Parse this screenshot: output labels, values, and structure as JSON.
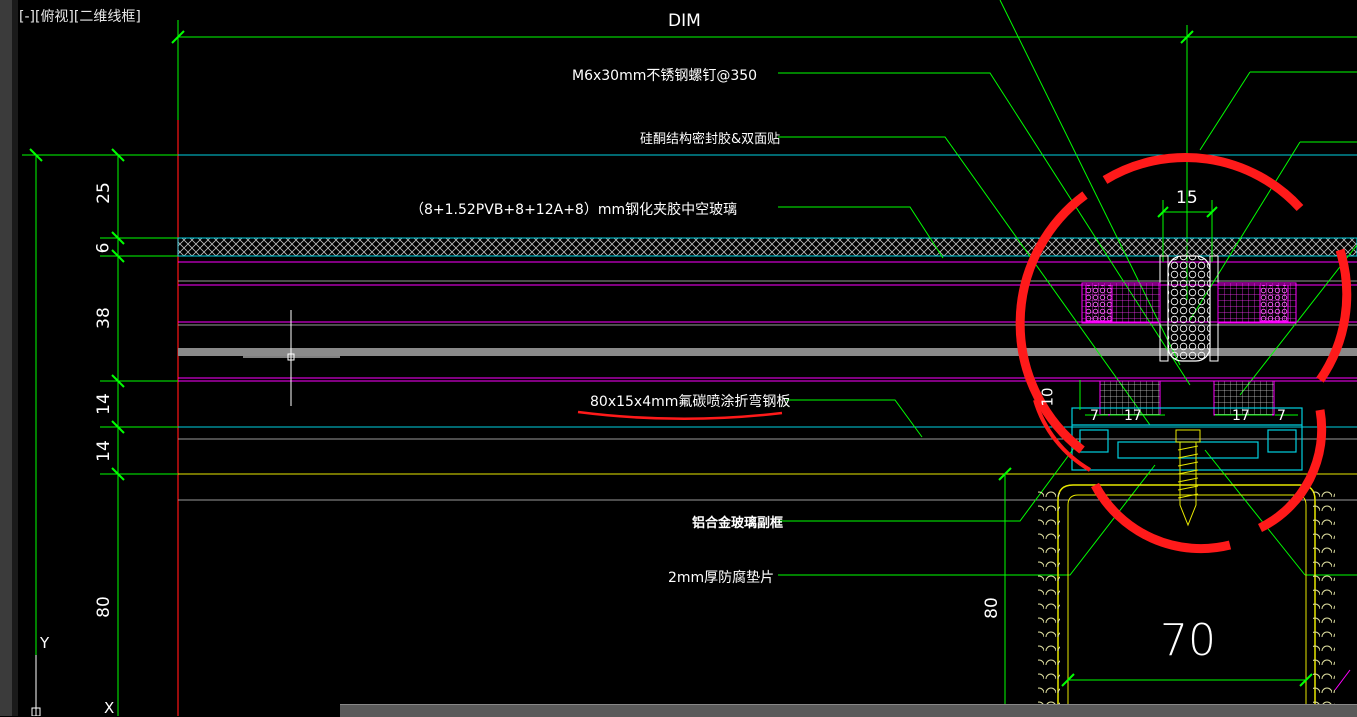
{
  "viewport": {
    "label": "[-][俯视][二维线框]"
  },
  "top_dim": {
    "text": "DIM"
  },
  "callouts": {
    "screw": "M6x30mm不锈钢螺钉@350",
    "sealant": "硅酮结构密封胶&双面贴",
    "glass": "（8+1.52PVB+8+12A+8）mm钢化夹胶中空玻璃",
    "steel_plate": "80x15x4mm氟碳喷涂折弯钢板",
    "frame": "铝合金玻璃副框",
    "gasket": "2mm厚防腐垫片"
  },
  "left_dims": [
    "25",
    "6",
    "38",
    "14",
    "14",
    "80"
  ],
  "detail_dims": {
    "gap": "15",
    "d10": "10",
    "d7a": "7",
    "d17a": "17",
    "d17b": "17",
    "d7b": "7",
    "d80": "80",
    "d70": "70"
  },
  "ucs": {
    "y": "Y",
    "x": "X"
  },
  "colors": {
    "background": "#000000",
    "dim_green": "#00ff00",
    "leader_green": "#00ff00",
    "cyan": "#00d0e0",
    "magenta": "#ff00ff",
    "yellow": "#e8e800",
    "red_markup": "#ff1a1a",
    "white": "#ffffff",
    "grey": "#9a9a9a"
  },
  "icons": [
    "crosshair-cursor-icon",
    "ucs-icon"
  ]
}
